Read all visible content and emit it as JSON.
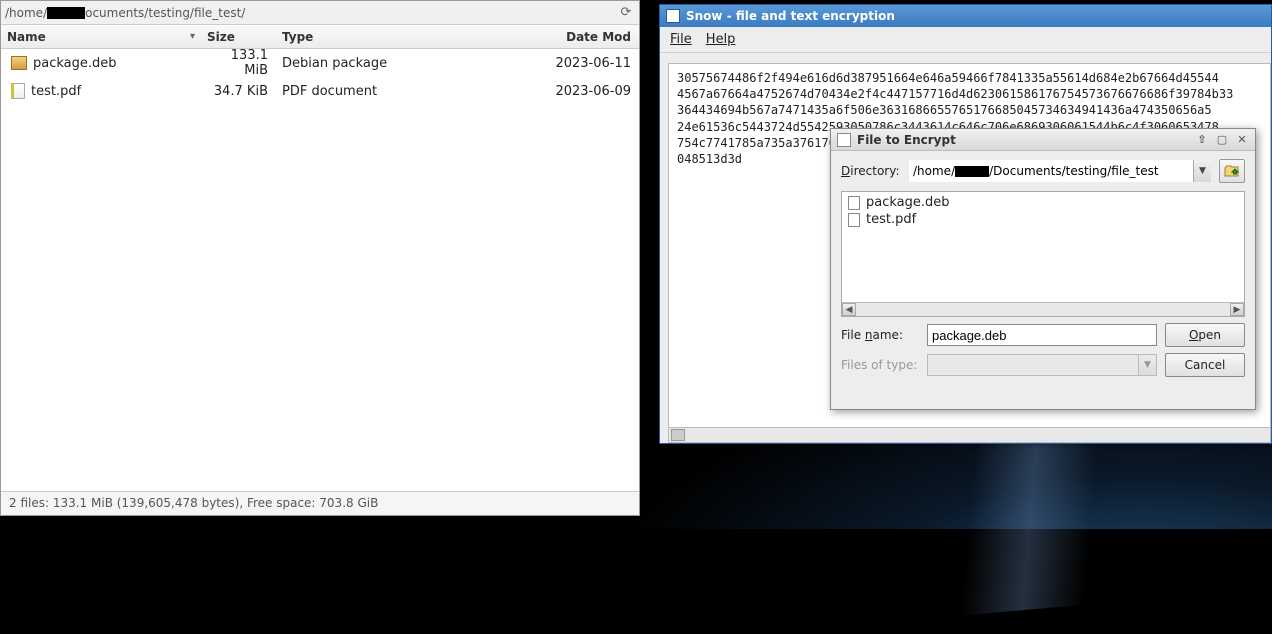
{
  "file_manager": {
    "path_prefix": "/home/",
    "path_suffix": "ocuments/testing/file_test/",
    "columns": {
      "name": "Name",
      "size": "Size",
      "type": "Type",
      "date": "Date Mod"
    },
    "files": [
      {
        "name": "package.deb",
        "size": "133.1 MiB",
        "type": "Debian package",
        "date": "2023-06-11",
        "icon": "deb"
      },
      {
        "name": "test.pdf",
        "size": "34.7 KiB",
        "type": "PDF document",
        "date": "2023-06-09",
        "icon": "pdf"
      }
    ],
    "status": "2 files: 133.1 MiB (139,605,478 bytes), Free space: 703.8 GiB"
  },
  "snow": {
    "title": "Snow - file and text encryption",
    "menu": {
      "file": "File",
      "help": "Help"
    },
    "text": "30575674486f2f494e616d6d387951664e646a59466f7841335a55614d684e2b67664d45544\n4567a67664a4752674d70434e2f4c447157716d4d623061586176754573676676686f39784b33\n364434694b567a7471435a6f506e3631686655765176685045734634941436a474350656a5\n24e61536c5443724d5542593050786c3443614c646c706e6869306061544b6c4f3060653478\n754c7741785a735a37617065\n048513d3d"
  },
  "chooser": {
    "title": "File to Encrypt",
    "directory_label": "Directory:",
    "directory_prefix": "/home/",
    "directory_suffix": "/Documents/testing/file_test",
    "items": [
      {
        "name": "package.deb"
      },
      {
        "name": "test.pdf"
      }
    ],
    "filename_label": "File name:",
    "filename_value": "package.deb",
    "filetype_label": "Files of type:",
    "open": "Open",
    "cancel": "Cancel"
  }
}
